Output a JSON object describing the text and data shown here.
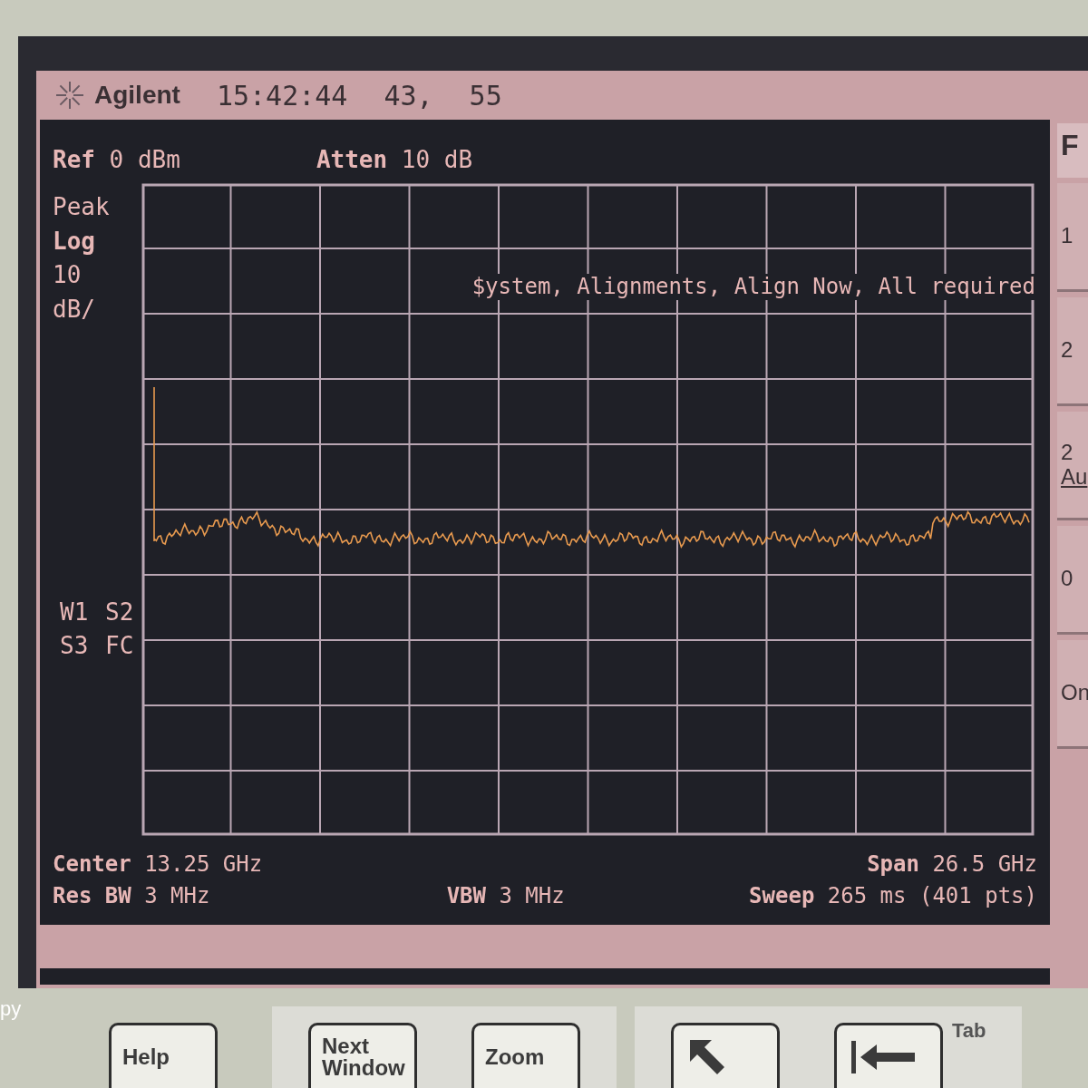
{
  "header": {
    "brand": "Agilent",
    "time": "15:42:44",
    "values": [
      "43,",
      "55"
    ]
  },
  "settings": [
    {
      "label": "Ref",
      "value": "0 dBm"
    },
    {
      "label": "Atten",
      "value": "10 dB"
    }
  ],
  "scale": [
    {
      "text": "Peak",
      "emphasis": false
    },
    {
      "text": "Log",
      "emphasis": true
    },
    {
      "text": "10",
      "emphasis": false
    },
    {
      "text": "dB/",
      "emphasis": false
    }
  ],
  "trace_flags": [
    "W1",
    "S2",
    "S3",
    "FC"
  ],
  "message": "$ystem, Alignments, Align Now, All required",
  "footer": {
    "left": [
      {
        "label": "Center",
        "value": "13.25 GHz"
      },
      {
        "label": "Res BW",
        "value": "3 MHz"
      }
    ],
    "middle": {
      "label": "VBW",
      "value": "3 MHz"
    },
    "right": [
      {
        "label": "Span",
        "value": "26.5 GHz"
      },
      {
        "label": "Sweep",
        "value": "265 ms (401 pts)"
      }
    ]
  },
  "softkey_title": "F",
  "softkeys": [
    {
      "lines": [
        "1"
      ]
    },
    {
      "lines": [
        "2"
      ]
    },
    {
      "lines": [
        "2",
        "Au"
      ]
    },
    {
      "lines": [
        "0"
      ]
    },
    {
      "lines": [
        "On"
      ]
    }
  ],
  "bezel_label": "py",
  "keys": [
    {
      "kind": "text",
      "label": "Help"
    },
    {
      "kind": "text",
      "label": "Next Window"
    },
    {
      "kind": "text",
      "label": "Zoom"
    },
    {
      "kind": "arrow"
    },
    {
      "kind": "tab",
      "label": "Tab"
    }
  ]
}
